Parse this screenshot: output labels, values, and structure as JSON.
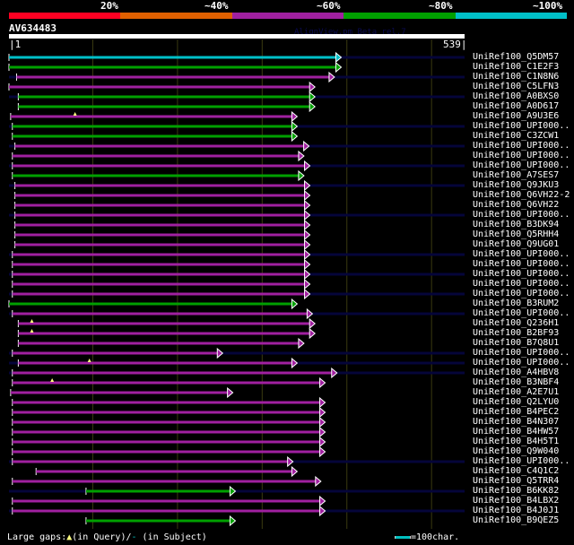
{
  "legend": {
    "percent_labels": [
      "20%",
      "~40%",
      "~60%",
      "~80%",
      "~100%"
    ],
    "colors": [
      "#ff0022",
      "#e06000",
      "#a020a0",
      "#00a000",
      "#00c0c8"
    ]
  },
  "query": {
    "name": "AV634483",
    "start": "1",
    "end": "539",
    "length": 539
  },
  "credit": "AlignView.pm Beta rel.7",
  "grid_every": 100,
  "navy": "#05053a",
  "hits": [
    {
      "name": "UniRef100_Q5DM57",
      "start": 1,
      "end": 387,
      "color": "#00c0c8",
      "bg": true
    },
    {
      "name": "UniRef100_C1E2F3",
      "start": 1,
      "end": 387,
      "color": "#00a000",
      "bg": false
    },
    {
      "name": "UniRef100_C1N8N6",
      "start": 10,
      "end": 379,
      "color": "#a020a0",
      "bg": true
    },
    {
      "name": "UniRef100_C5LFN3",
      "start": 1,
      "end": 356,
      "color": "#a020a0",
      "bg": false
    },
    {
      "name": "UniRef100_A0BXS0",
      "start": 12,
      "end": 356,
      "color": "#00a000",
      "bg": true
    },
    {
      "name": "UniRef100_A0D617",
      "start": 12,
      "end": 356,
      "color": "#00a000",
      "bg": false
    },
    {
      "name": "UniRef100_A9U3E6",
      "start": 3,
      "end": 335,
      "color": "#a020a0",
      "bg": false,
      "gap": 79
    },
    {
      "name": "UniRef100_UPI000..",
      "start": 5,
      "end": 335,
      "color": "#00a000",
      "bg": true
    },
    {
      "name": "UniRef100_C3ZCW1",
      "start": 5,
      "end": 335,
      "color": "#00a000",
      "bg": false
    },
    {
      "name": "UniRef100_UPI000..",
      "start": 8,
      "end": 349,
      "color": "#a020a0",
      "bg": true
    },
    {
      "name": "UniRef100_UPI000..",
      "start": 5,
      "end": 343,
      "color": "#a020a0",
      "bg": false
    },
    {
      "name": "UniRef100_UPI000..",
      "start": 5,
      "end": 350,
      "color": "#a020a0",
      "bg": true
    },
    {
      "name": "UniRef100_A7SES7",
      "start": 5,
      "end": 343,
      "color": "#00a000",
      "bg": false
    },
    {
      "name": "UniRef100_Q9JKU3",
      "start": 8,
      "end": 350,
      "color": "#a020a0",
      "bg": true
    },
    {
      "name": "UniRef100_Q6VH22-2",
      "start": 8,
      "end": 350,
      "color": "#a020a0",
      "bg": false
    },
    {
      "name": "UniRef100_Q6VH22",
      "start": 8,
      "end": 350,
      "color": "#a020a0",
      "bg": false
    },
    {
      "name": "UniRef100_UPI000..",
      "start": 8,
      "end": 350,
      "color": "#a020a0",
      "bg": true
    },
    {
      "name": "UniRef100_B3DK94",
      "start": 8,
      "end": 350,
      "color": "#a020a0",
      "bg": false
    },
    {
      "name": "UniRef100_Q5RHH4",
      "start": 8,
      "end": 350,
      "color": "#a020a0",
      "bg": false
    },
    {
      "name": "UniRef100_Q9UG01",
      "start": 8,
      "end": 350,
      "color": "#a020a0",
      "bg": false
    },
    {
      "name": "UniRef100_UPI000..",
      "start": 5,
      "end": 350,
      "color": "#a020a0",
      "bg": true
    },
    {
      "name": "UniRef100_UPI000..",
      "start": 5,
      "end": 350,
      "color": "#a020a0",
      "bg": false
    },
    {
      "name": "UniRef100_UPI000..",
      "start": 5,
      "end": 350,
      "color": "#a020a0",
      "bg": true
    },
    {
      "name": "UniRef100_UPI000..",
      "start": 5,
      "end": 350,
      "color": "#a020a0",
      "bg": false
    },
    {
      "name": "UniRef100_UPI000..",
      "start": 5,
      "end": 350,
      "color": "#a020a0",
      "bg": true
    },
    {
      "name": "UniRef100_B3RUM2",
      "start": 1,
      "end": 335,
      "color": "#00a000",
      "bg": false
    },
    {
      "name": "UniRef100_UPI000..",
      "start": 5,
      "end": 353,
      "color": "#a020a0",
      "bg": true
    },
    {
      "name": "UniRef100_Q236H1",
      "start": 12,
      "end": 356,
      "color": "#a020a0",
      "bg": false,
      "gap": 28
    },
    {
      "name": "UniRef100_B2BF93",
      "start": 12,
      "end": 356,
      "color": "#a020a0",
      "bg": false,
      "gap": 28
    },
    {
      "name": "UniRef100_B7Q8U1",
      "start": 12,
      "end": 343,
      "color": "#a020a0",
      "bg": false
    },
    {
      "name": "UniRef100_UPI000..",
      "start": 5,
      "end": 247,
      "color": "#a020a0",
      "bg": true
    },
    {
      "name": "UniRef100_UPI000..",
      "start": 12,
      "end": 335,
      "color": "#a020a0",
      "bg": true,
      "gap": 96
    },
    {
      "name": "UniRef100_A4HBV8",
      "start": 5,
      "end": 382,
      "color": "#a020a0",
      "bg": true
    },
    {
      "name": "UniRef100_B3NBF4",
      "start": 5,
      "end": 368,
      "color": "#a020a0",
      "bg": false,
      "gap": 52
    },
    {
      "name": "UniRef100_A2E7U1",
      "start": 3,
      "end": 259,
      "color": "#a020a0",
      "bg": false
    },
    {
      "name": "UniRef100_Q2LYU0",
      "start": 5,
      "end": 368,
      "color": "#a020a0",
      "bg": false
    },
    {
      "name": "UniRef100_B4PEC2",
      "start": 5,
      "end": 368,
      "color": "#a020a0",
      "bg": false
    },
    {
      "name": "UniRef100_B4N307",
      "start": 5,
      "end": 368,
      "color": "#a020a0",
      "bg": false
    },
    {
      "name": "UniRef100_B4HW57",
      "start": 5,
      "end": 368,
      "color": "#a020a0",
      "bg": false
    },
    {
      "name": "UniRef100_B4H5T1",
      "start": 5,
      "end": 368,
      "color": "#a020a0",
      "bg": false
    },
    {
      "name": "UniRef100_Q9W040",
      "start": 5,
      "end": 368,
      "color": "#a020a0",
      "bg": false
    },
    {
      "name": "UniRef100_UPI000..",
      "start": 5,
      "end": 330,
      "color": "#a020a0",
      "bg": true
    },
    {
      "name": "UniRef100_C4Q1C2",
      "start": 33,
      "end": 335,
      "color": "#a020a0",
      "bg": false
    },
    {
      "name": "UniRef100_Q5TRR4",
      "start": 5,
      "end": 363,
      "color": "#a020a0",
      "bg": false
    },
    {
      "name": "UniRef100_B6KK82",
      "start": 92,
      "end": 262,
      "color": "#00a000",
      "bg": true
    },
    {
      "name": "UniRef100_B4LBX2",
      "start": 5,
      "end": 368,
      "color": "#a020a0",
      "bg": false
    },
    {
      "name": "UniRef100_B4J0J1",
      "start": 5,
      "end": 368,
      "color": "#a020a0",
      "bg": true
    },
    {
      "name": "UniRef100_B9QEZ5",
      "start": 92,
      "end": 262,
      "color": "#00a000",
      "bg": false
    }
  ],
  "footer": {
    "large_gaps": "Large gaps:",
    "query_glyph": "▲",
    "in_query": "(in Query)/",
    "subject_glyph": "-",
    "in_subject": " (in Subject)",
    "scale": "=100char."
  }
}
